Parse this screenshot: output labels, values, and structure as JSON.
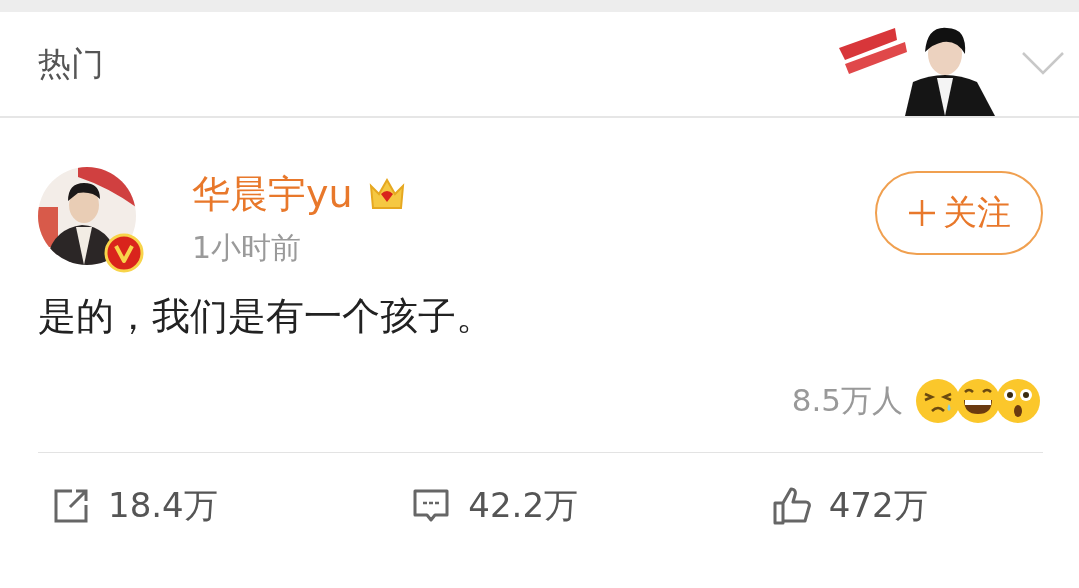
{
  "header": {
    "title": "热门"
  },
  "post": {
    "author": "华晨宇yu",
    "time": "1小时前",
    "follow_button": "关注",
    "text": "是的，我们是有一个孩子。",
    "reactions_count": "8.5万人",
    "actions": [
      {
        "kind": "repost",
        "count": "18.4万"
      },
      {
        "kind": "comment",
        "count": "42.2万"
      },
      {
        "kind": "like",
        "count": "472万"
      }
    ]
  }
}
